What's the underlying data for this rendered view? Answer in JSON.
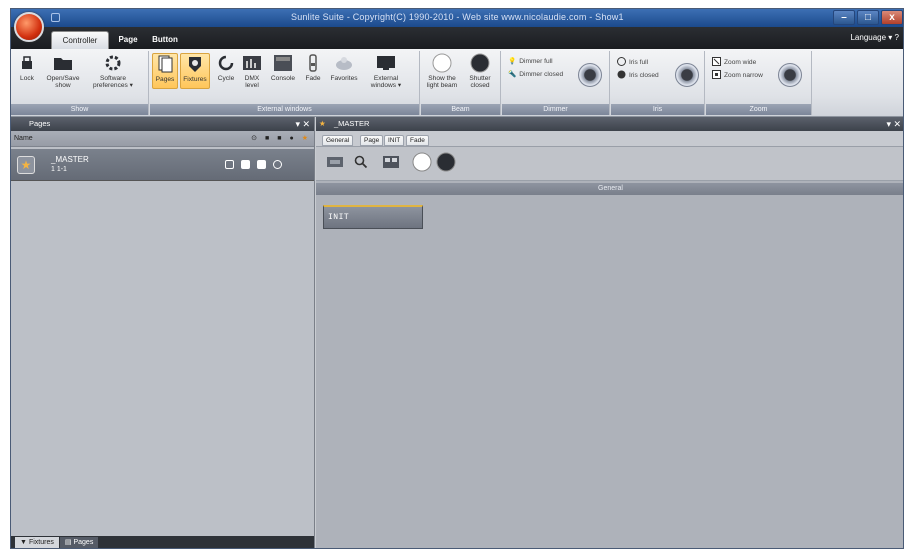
{
  "app": {
    "title": "Sunlite Suite - Copyright(C) 1990-2010 - Web site www.nicolaudie.com - Show1"
  },
  "ribbon_tabs": [
    {
      "label": "Controller"
    },
    {
      "label": "Page"
    },
    {
      "label": "Button"
    }
  ],
  "language_label": "Language ▾ ?",
  "groups": {
    "show": {
      "label": "Show",
      "buttons": [
        {
          "label": "Lock",
          "icon": "lock-icon"
        },
        {
          "label": "Open/Save show",
          "icon": "folder-icon"
        },
        {
          "label": "Software preferences ▾",
          "icon": "gear-icon"
        }
      ]
    },
    "external_windows": {
      "label": "External windows",
      "buttons": [
        {
          "label": "Pages",
          "icon": "pages-icon"
        },
        {
          "label": "Fixtures",
          "icon": "fixtures-icon"
        },
        {
          "label": "Cycle",
          "icon": "cycle-icon"
        },
        {
          "label": "DMX level",
          "icon": "dmx-icon"
        },
        {
          "label": "Console",
          "icon": "console-icon"
        },
        {
          "label": "Fade",
          "icon": "fade-icon"
        },
        {
          "label": "Favorites",
          "icon": "favorites-icon"
        },
        {
          "label": "External windows ▾",
          "icon": "monitor-icon"
        }
      ]
    },
    "beam": {
      "label": "Beam",
      "buttons": [
        {
          "label": "Show the light beam",
          "icon": "beam-open-icon"
        },
        {
          "label": "Shutter closed",
          "icon": "shutter-closed-icon"
        }
      ]
    },
    "dimmer": {
      "label": "Dimmer",
      "items": [
        {
          "label": "Dimmer full",
          "icon": "bulb-on-icon"
        },
        {
          "label": "Dimmer closed",
          "icon": "bulb-off-icon"
        }
      ]
    },
    "iris": {
      "label": "Iris",
      "items": [
        {
          "label": "Iris full",
          "icon": "iris-full-icon"
        },
        {
          "label": "Iris closed",
          "icon": "iris-closed-icon"
        }
      ]
    },
    "zoom": {
      "label": "Zoom",
      "items": [
        {
          "label": "Zoom wide",
          "icon": "zoom-wide-icon"
        },
        {
          "label": "Zoom narrow",
          "icon": "zoom-narrow-icon"
        }
      ]
    }
  },
  "pages_panel": {
    "title": "Pages",
    "column_header": "Name",
    "row": {
      "name": "_MASTER",
      "sub": "1  1-1"
    },
    "bottom_tabs": [
      {
        "label": "Fixtures"
      },
      {
        "label": "Pages"
      }
    ]
  },
  "master_panel": {
    "title": "_MASTER",
    "tabs": [
      {
        "label": "General"
      },
      {
        "label": "Page"
      },
      {
        "label": "INIT"
      },
      {
        "label": "Fade"
      }
    ],
    "section_label": "General",
    "buttons": [
      {
        "label": "INIT"
      }
    ]
  }
}
